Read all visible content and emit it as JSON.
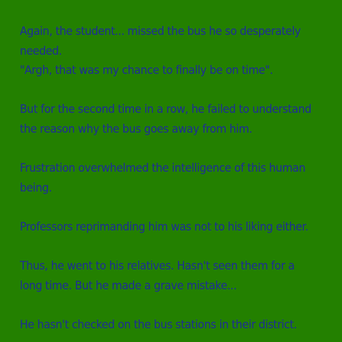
{
  "story": {
    "paragraphs": [
      {
        "lines": [
          "Again, the student... missed the bus he so desperately needed.",
          "\"Argh, that was my chance to finally be on time\"."
        ]
      },
      {
        "lines": [
          "But for the second time in a row, he failed to understand the reason why the bus goes away from him."
        ]
      },
      {
        "lines": [
          "Frustration overwhelmed the intelligence of this human being."
        ]
      },
      {
        "lines": [
          "Professors reprimanding him was not to his liking either."
        ]
      },
      {
        "lines": [
          "Thus, he went to his relatives. Hasn't seen them for a long time. But he made a grave mistake..."
        ]
      },
      {
        "lines": [
          "He hasn't checked on the bus stations in their district."
        ]
      }
    ]
  },
  "colors": {
    "background": "#238000",
    "text": "#1d2d96"
  }
}
